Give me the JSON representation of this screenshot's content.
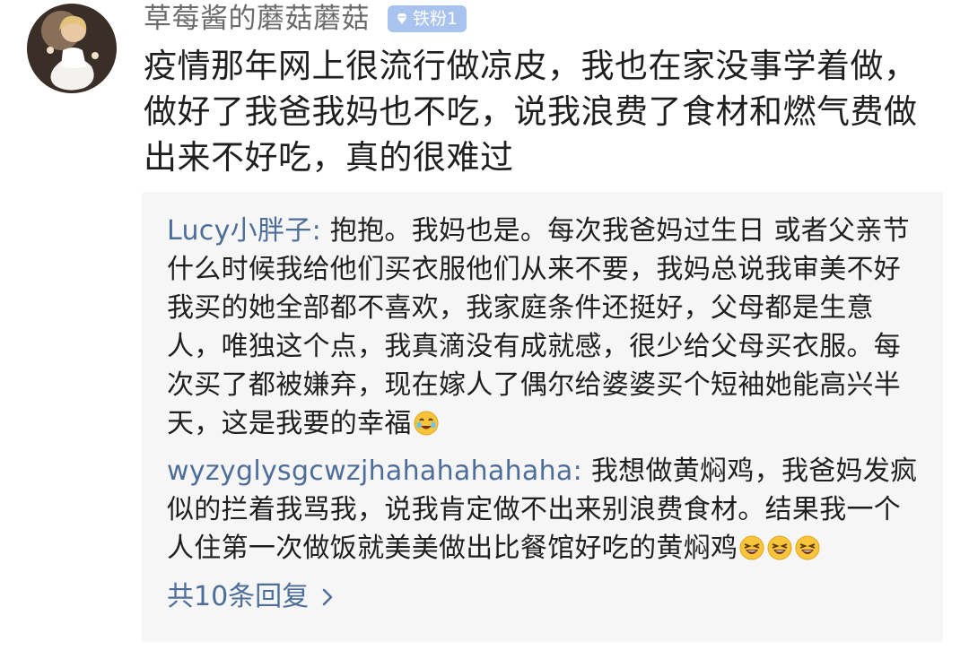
{
  "post": {
    "username": "草莓酱的蘑菇蘑菇",
    "badge": {
      "icon": "diamond-icon",
      "label": "铁粉1",
      "color": "#a8c4ee"
    },
    "text": "疫情那年网上很流行做凉皮，我也在家没事学着做，做好了我爸我妈也不吃，说我浪费了食材和燃气费做出来不好吃，真的很难过"
  },
  "replies": [
    {
      "author": "Lucy小胖子",
      "separator": ":",
      "text": " 抱抱。我妈也是。每次我爸妈过生日 或者父亲节什么时候我给他们买衣服他们从来不要，我妈总说我审美不好 我买的她全部都不喜欢，我家庭条件还挺好，父母都是生意人，唯独这个点，我真滴没有成就感，很少给父母买衣服。每次买了都被嫌弃，现在嫁人了偶尔给婆婆买个短袖她能高兴半天，这是我要的幸福",
      "emojis": [
        "crying-smile-emoji"
      ]
    },
    {
      "author": "wyzyglysgcwzjhahahahahaha",
      "separator": ":",
      "text": " 我想做黄焖鸡，我爸妈发疯似的拦着我骂我，说我肯定做不出来别浪费食材。结果我一个人住第一次做饭就美美做出比餐馆好吃的黄焖鸡",
      "emojis": [
        "laughing-tears-emoji",
        "laughing-tears-emoji",
        "laughing-tears-emoji"
      ]
    }
  ],
  "more_replies": {
    "label": "共10条回复",
    "icon": "chevron-right-icon"
  },
  "colors": {
    "link": "#4e6e9a",
    "reply_background": "#f6f6f6",
    "username": "#6b6b6b"
  }
}
